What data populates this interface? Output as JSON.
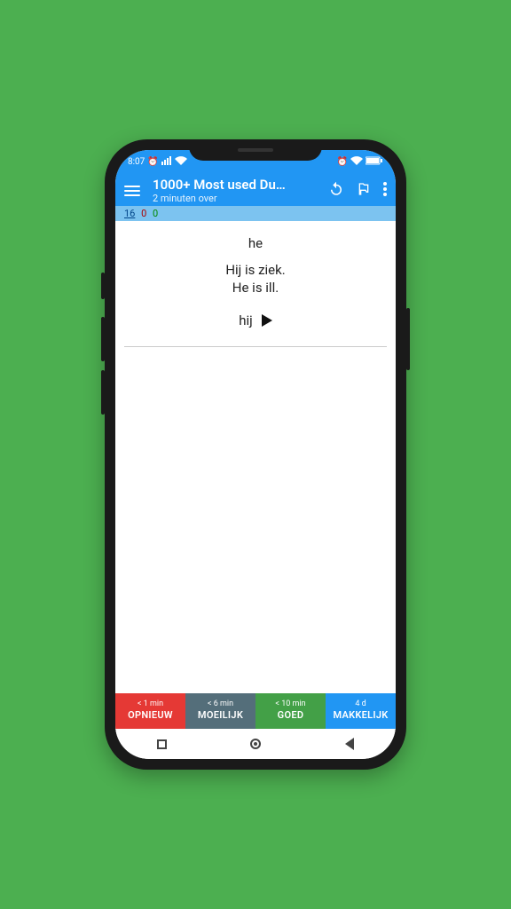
{
  "statusbar": {
    "time": "8:07"
  },
  "appbar": {
    "title": "1000+ Most used Du…",
    "subtitle": "2 minuten over"
  },
  "counts": {
    "a": "16",
    "b": "0",
    "c": "0"
  },
  "card": {
    "prompt": "he",
    "example_nl": "Hij is ziek.",
    "example_en": "He is ill.",
    "answer_word": "hij"
  },
  "buttons": [
    {
      "time": "< 1 min",
      "label": "OPNIEUW"
    },
    {
      "time": "< 6 min",
      "label": "MOEILIJK"
    },
    {
      "time": "< 10 min",
      "label": "GOED"
    },
    {
      "time": "4 d",
      "label": "MAKKELIJK"
    }
  ]
}
